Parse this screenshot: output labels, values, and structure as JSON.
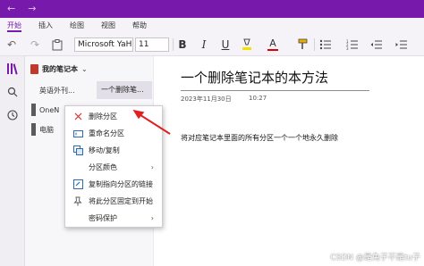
{
  "menubar": {
    "tabs": [
      "开始",
      "插入",
      "绘图",
      "视图",
      "帮助"
    ],
    "active": "开始"
  },
  "toolbar": {
    "font_name": "Microsoft YaH",
    "font_size": "11",
    "bold_label": "B",
    "italic_label": "I",
    "underline_label": "U",
    "font_color_label": "A"
  },
  "notebook": {
    "name": "我的笔记本"
  },
  "sections": [
    {
      "label": "英语外刊...",
      "color": "#f7f6f9"
    },
    {
      "label": "OneN",
      "color": "#5b5b5b"
    },
    {
      "label": "电脑",
      "color": "#5b5b5b"
    }
  ],
  "pages": [
    {
      "label": "一个删除笔..."
    }
  ],
  "note": {
    "title": "一个删除笔记本的本方法",
    "date": "2023年11月30日",
    "time": "10:27",
    "body": "将对应笔记本里面的所有分区一个一个地永久删除"
  },
  "context_menu": [
    {
      "label": "删除分区",
      "icon": "delete-x-icon"
    },
    {
      "label": "重命名分区",
      "icon": "rename-icon"
    },
    {
      "label": "移动/复制",
      "icon": "move-copy-icon"
    },
    {
      "label": "分区颜色",
      "icon": "",
      "submenu": true
    },
    {
      "label": "复制指向分区的链接",
      "icon": "link-icon"
    },
    {
      "label": "将此分区固定到开始",
      "icon": "pin-icon"
    },
    {
      "label": "密码保护",
      "icon": "",
      "submenu": true
    }
  ],
  "colors": {
    "accent": "#7719aa",
    "arrow": "#e02020",
    "delete_icon": "#d13438"
  },
  "watermark": "CSDN @是兔子不是tu子"
}
